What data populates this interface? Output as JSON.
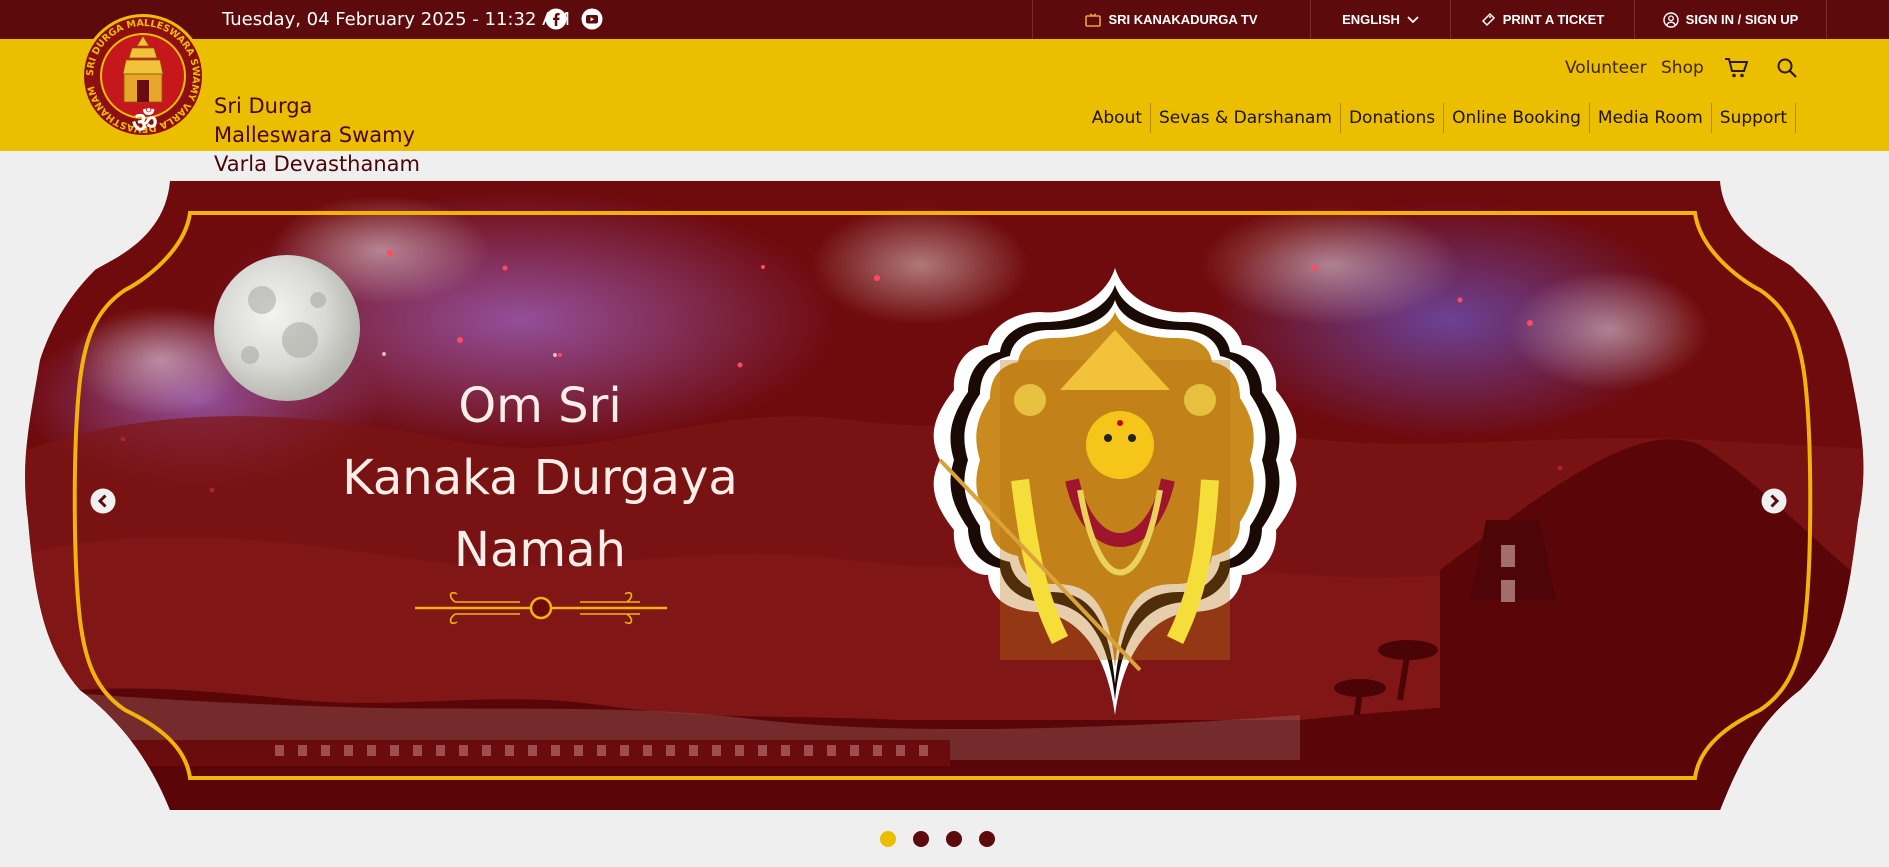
{
  "topbar": {
    "datetime": "Tuesday, 04 February 2025 - 11:32 AM",
    "social": [
      "facebook-icon",
      "youtube-icon"
    ],
    "tv_label": "SRI KANAKADURGA TV",
    "language_label": "ENGLISH",
    "print_label": "PRINT A TICKET",
    "sign_label": "SIGN IN / SIGN UP"
  },
  "header": {
    "brand_line1": "Sri Durga",
    "brand_line2": "Malleswara Swamy",
    "brand_line3": "Varla Devasthanam",
    "logo_text": "SRI DURGA MALLESWARA SWAMY VARLA DEVASTHANAM",
    "volunteer_label": "Volunteer",
    "shop_label": "Shop",
    "nav": [
      "About",
      "Sevas & Darshanam",
      "Donations",
      "Online Booking",
      "Media Room",
      "Support"
    ]
  },
  "hero": {
    "title_line1": "Om Sri",
    "title_line2": "Kanaka Durgaya",
    "title_line3": "Namah",
    "slides_count": 4,
    "active_slide": 1
  },
  "colors": {
    "maroon": "#5c0a0c",
    "gold": "#ecbe00",
    "banner": "#6f0a0d",
    "accent_gold": "#f2b40a"
  }
}
